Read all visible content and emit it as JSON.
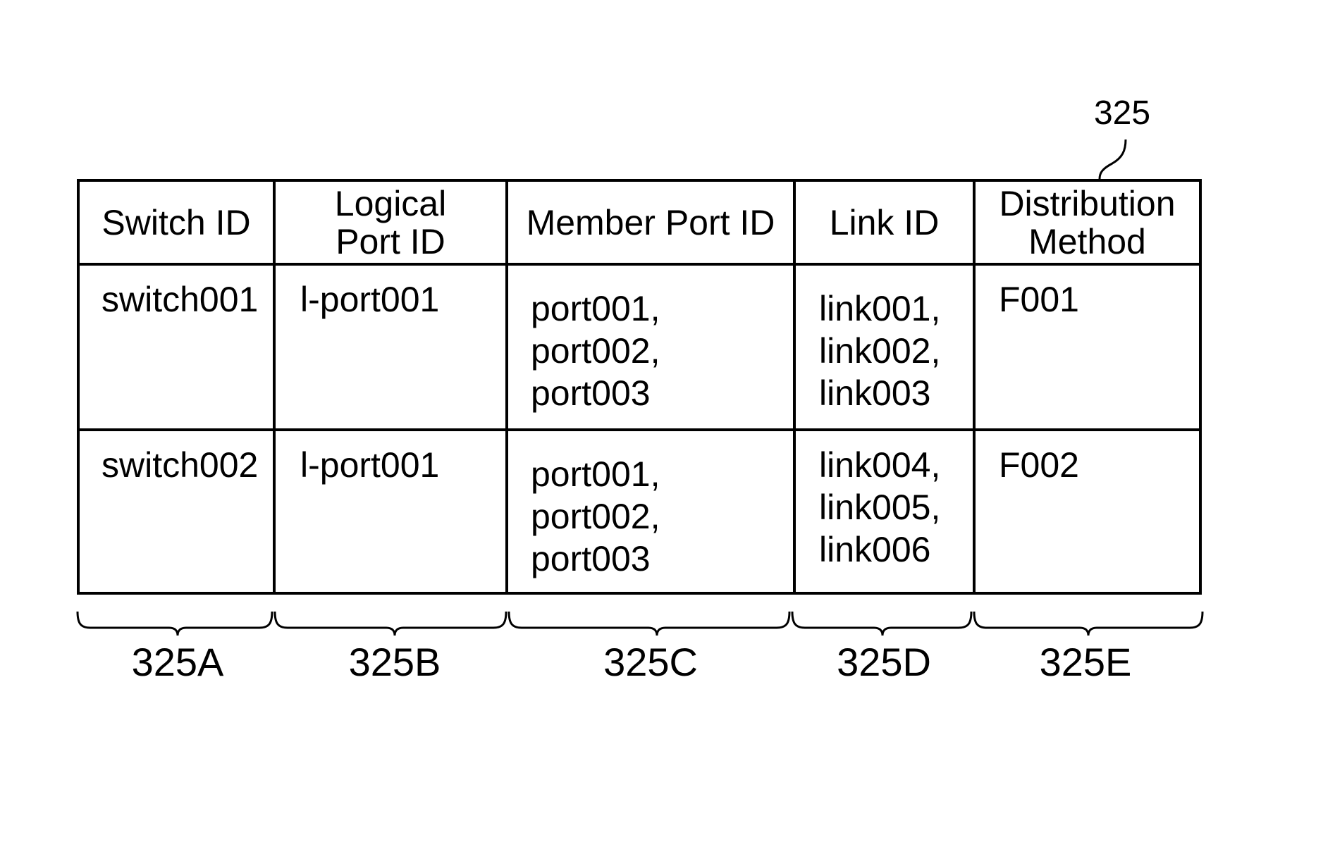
{
  "figure": {
    "reference_number": "325",
    "table": {
      "columns": [
        {
          "header": [
            "Switch ID"
          ],
          "label": "325A"
        },
        {
          "header": [
            "Logical",
            "Port ID"
          ],
          "label": "325B"
        },
        {
          "header": [
            "Member Port ID"
          ],
          "label": "325C"
        },
        {
          "header": [
            "Link ID"
          ],
          "label": "325D"
        },
        {
          "header": [
            "Distribution",
            "Method"
          ],
          "label": "325E"
        }
      ],
      "rows": [
        {
          "switch_id": "switch001",
          "logical_port_id": "l-port001",
          "member_port_ids": [
            "port001,",
            "port002,",
            "port003"
          ],
          "link_ids": [
            "link001,",
            "link002,",
            "link003"
          ],
          "distribution_method": "F001"
        },
        {
          "switch_id": "switch002",
          "logical_port_id": "l-port001",
          "member_port_ids": [
            "port001,",
            "port002,",
            "port003"
          ],
          "link_ids": [
            "link004,",
            "link005,",
            "link006"
          ],
          "distribution_method": "F002"
        }
      ]
    }
  }
}
